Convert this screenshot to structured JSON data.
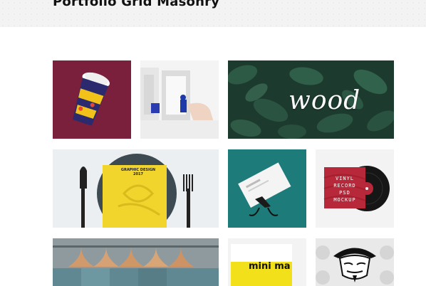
{
  "header": {
    "title": "Portfolio Grid Masonry"
  },
  "grid": {
    "items": [
      {
        "name": "coffee-cup-mockup"
      },
      {
        "name": "wall-shelf-photo"
      },
      {
        "name": "wood-leaves-banner",
        "overlay_text": "wood"
      },
      {
        "name": "graphic-design-book-plate",
        "overlay_text": "GRAPHIC DESIGN 2017"
      },
      {
        "name": "business-card-clip"
      },
      {
        "name": "vinyl-record-mockup",
        "overlay_text": "VINYL RECORD PSD MOCKUP"
      },
      {
        "name": "clothes-hangers-photo"
      },
      {
        "name": "mini-magazine-cover",
        "overlay_text": "mini ma"
      },
      {
        "name": "mask-illustration"
      }
    ]
  },
  "colors": {
    "header_bg": "#f3f3f3",
    "cup_bg": "#7a1f3c",
    "leaves_bg": "#1f3b30",
    "card_bg": "#1f7a78",
    "book_yellow": "#f1d42c",
    "vinyl_red": "#b7283a"
  }
}
